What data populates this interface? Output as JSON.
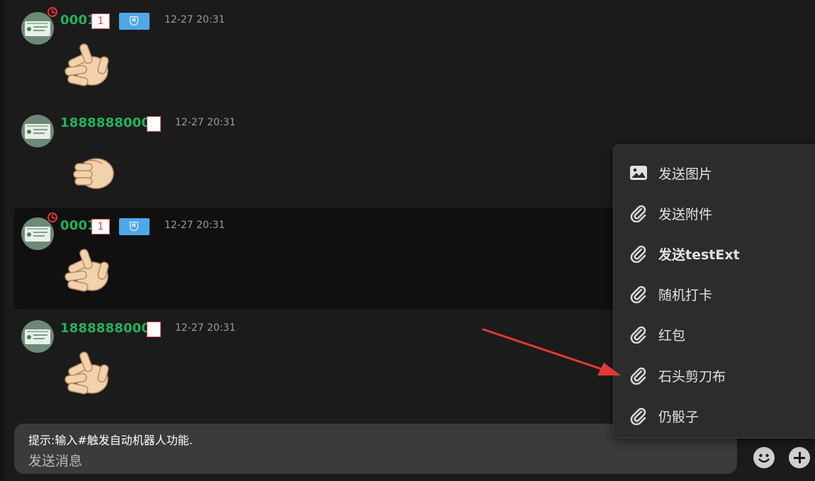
{
  "messages": [
    {
      "name": "0001",
      "badge": "1",
      "time": "12-27 20:31"
    },
    {
      "name": "18888880006",
      "time": "12-27 20:31"
    },
    {
      "name": "0001",
      "badge": "1",
      "time": "12-27 20:31"
    },
    {
      "name": "18888880006",
      "time": "12-27 20:31"
    }
  ],
  "input": {
    "hint": "提示:输入#触发自动机器人功能.",
    "placeholder": "发送消息"
  },
  "menu": {
    "items": [
      {
        "label": "发送图片",
        "icon": "image-icon"
      },
      {
        "label": "发送附件",
        "icon": "paperclip-icon"
      },
      {
        "label": "发送testExt",
        "icon": "paperclip-icon"
      },
      {
        "label": "随机打卡",
        "icon": "paperclip-icon"
      },
      {
        "label": "红包",
        "icon": "paperclip-icon"
      },
      {
        "label": "石头剪刀布",
        "icon": "paperclip-icon"
      },
      {
        "label": "仍骰子",
        "icon": "paperclip-icon"
      }
    ]
  },
  "colors": {
    "background": "#1b1b1b",
    "username": "#25b15d",
    "annotation_arrow": "#e53935",
    "vip_badge": "#4fa8e8"
  }
}
